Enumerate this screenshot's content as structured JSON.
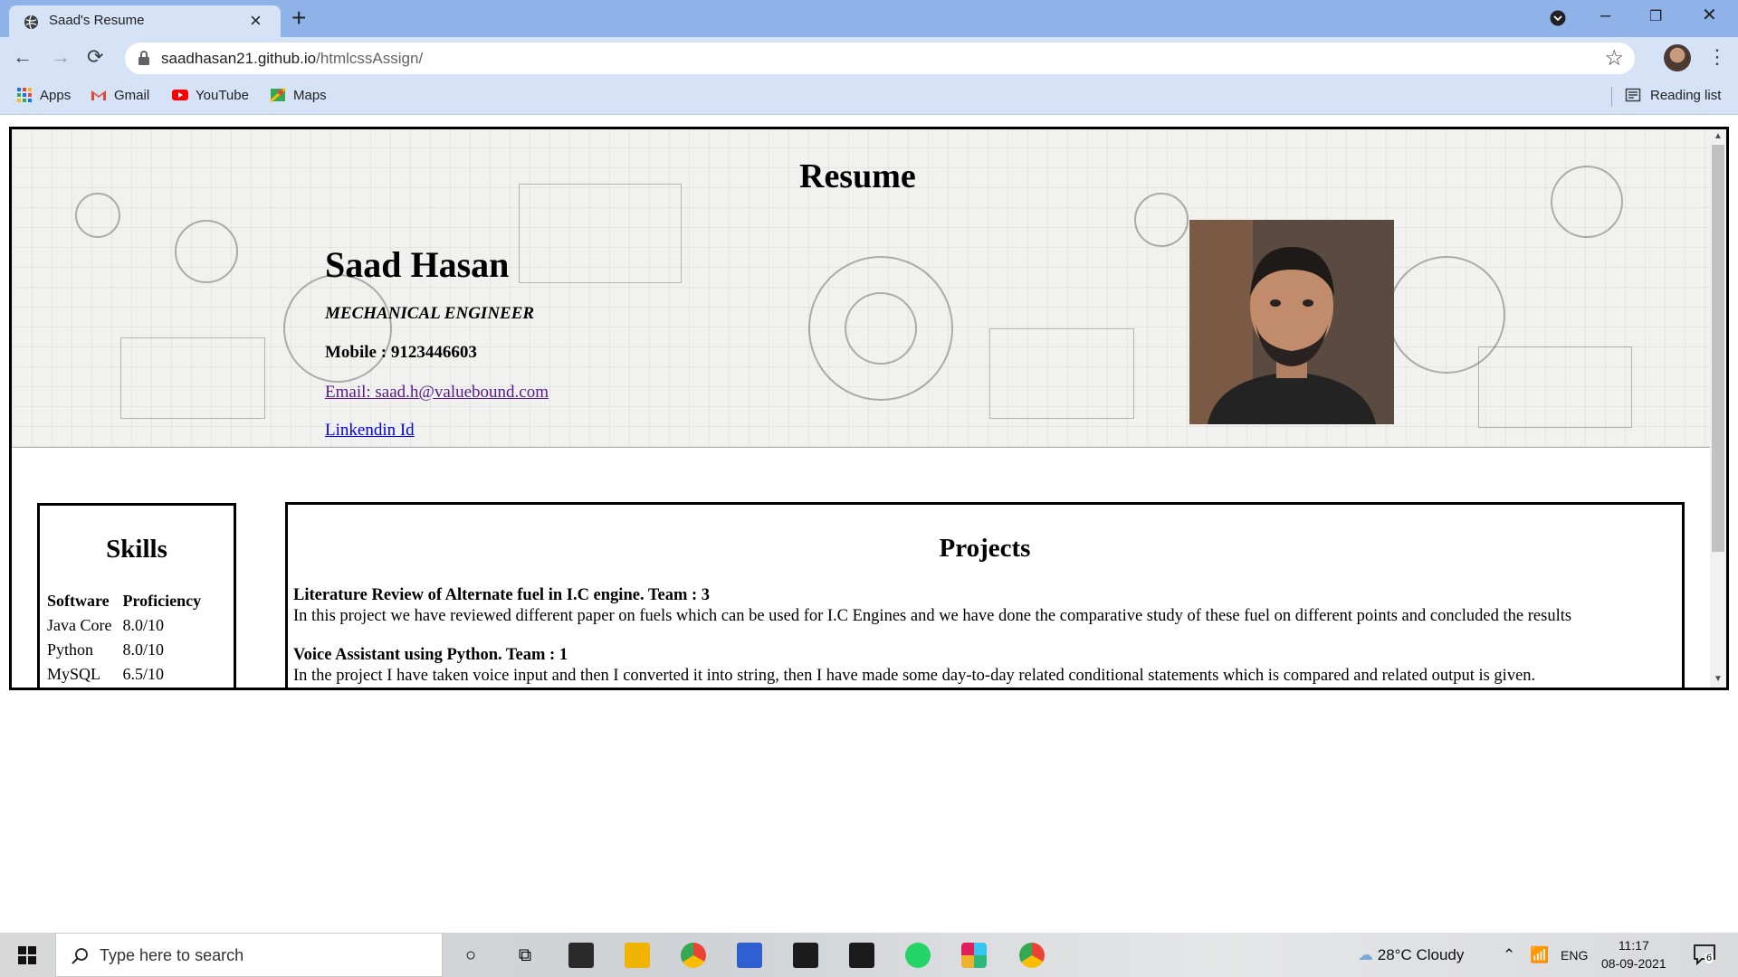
{
  "browser": {
    "tab_title": "Saad's Resume",
    "url_host": "saadhasan21.github.io",
    "url_path": "/htmlcssAssign/",
    "bookmarks": [
      "Apps",
      "Gmail",
      "YouTube",
      "Maps"
    ],
    "reading_list": "Reading list"
  },
  "resume": {
    "title": "Resume",
    "name": "Saad Hasan",
    "role": "MECHANICAL ENGINEER",
    "mobile": "Mobile : 9123446603",
    "email": "Email: saad.h@valuebound.com",
    "linkedin": "Linkendin Id"
  },
  "skills": {
    "title": "Skills",
    "headers": [
      "Software",
      "Proficiency"
    ],
    "rows": [
      [
        "Java Core",
        "8.0/10"
      ],
      [
        "Python",
        "8.0/10"
      ],
      [
        "MySQL",
        "6.5/10"
      ]
    ]
  },
  "projects": {
    "title": "Projects",
    "items": [
      {
        "heading": "Literature Review of Alternate fuel in I.C engine. Team : 3",
        "description": "In this project we have reviewed different paper on fuels which can be used for I.C Engines and we have done the comparative study of these fuel on different points and concluded the results"
      },
      {
        "heading": "Voice Assistant using Python. Team : 1",
        "description": "In the project I have taken voice input and then I converted it into string, then I have made some day-to-day related conditional statements which is compared and related output is given."
      }
    ]
  },
  "taskbar": {
    "search_placeholder": "Type here to search",
    "weather": "28°C  Cloudy",
    "lang": "ENG",
    "time": "11:17",
    "date": "08-09-2021",
    "notifications": "6"
  }
}
